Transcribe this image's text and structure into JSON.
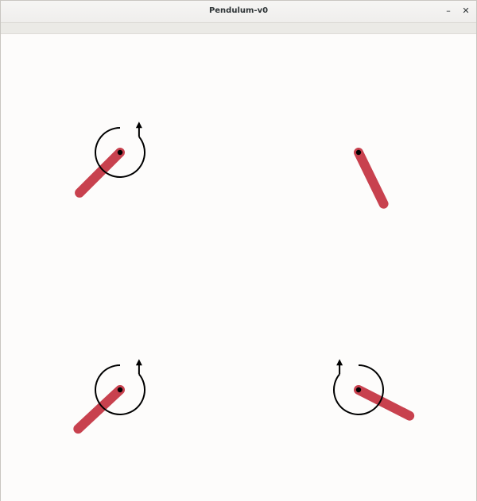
{
  "window": {
    "title": "Pendulum-v0",
    "minimize_label": "–",
    "close_label": "✕"
  },
  "colors": {
    "rod": "#c8414e",
    "axle": "#000000",
    "arrow": "#000000",
    "background": "#fdfcfb"
  },
  "icons": {
    "minimize": "minimize-icon",
    "close": "close-icon",
    "torque": "torque-arrow-icon"
  },
  "pendulums": [
    {
      "name": "pendulum-top-left",
      "angle_deg": 135,
      "has_torque": true,
      "torque_direction": "counterclockwise"
    },
    {
      "name": "pendulum-top-right",
      "angle_deg": 206,
      "has_torque": false,
      "torque_direction": ""
    },
    {
      "name": "pendulum-bottom-left",
      "angle_deg": 133,
      "has_torque": true,
      "torque_direction": "counterclockwise"
    },
    {
      "name": "pendulum-bottom-right",
      "angle_deg": 243,
      "has_torque": true,
      "torque_direction": "clockwise"
    }
  ]
}
